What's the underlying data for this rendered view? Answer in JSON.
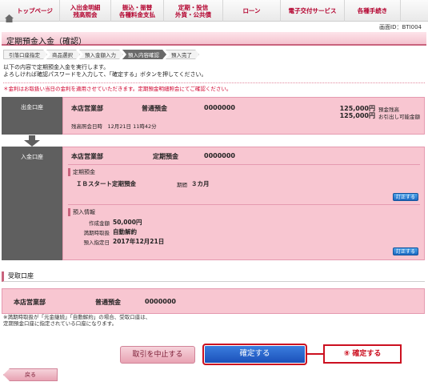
{
  "nav": {
    "items": [
      {
        "label": "トップページ"
      },
      {
        "label": "入出金明細\n残高照会"
      },
      {
        "label": "振込・振替\n各種料金支払"
      },
      {
        "label": "定期・投信\n外貨・公共債"
      },
      {
        "label": "ローン"
      },
      {
        "label": "電子交付サービス"
      },
      {
        "label": "各種手続き"
      }
    ]
  },
  "screen_id": "画面ID：BTI004",
  "page_title": "定期預金入金（確認）",
  "steps": [
    "引落口座指定",
    "商品選択",
    "預入金額入力",
    "預入内容確認",
    "預入完了"
  ],
  "instructions": {
    "line1": "以下の内容で定期預金入金を実行します。",
    "line2": "よろしければ確認パスワードを入力して、「確定する」ボタンを押してください。"
  },
  "notice": "＊金利はお取扱い当日の金利を適用させていただきます。定期預金明細照会にてご確認ください。",
  "withdrawal": {
    "label": "出金口座",
    "branch": "本店営業部",
    "type": "普通預金",
    "account": "0000000",
    "balance_amount": "125,000円",
    "balance_label": "預金残高",
    "available_amount": "125,000円",
    "available_label": "お引出し可能金額",
    "as_of": "残高照会日時　12月21日 11時42分"
  },
  "deposit": {
    "label": "入金口座",
    "branch": "本店営業部",
    "type": "定期預金",
    "account": "0000000",
    "product_section_title": "定期預金",
    "product_name": "ＩＢスタート定期預金",
    "term_label": "期間",
    "term_value": "３カ月",
    "edit_label": "訂正する",
    "info_section_title": "預入情報",
    "amount_label": "作成金額",
    "amount_value": "50,000円",
    "maturity_label": "満期時取扱",
    "maturity_value": "自動解約",
    "date_label": "預入指定日",
    "date_value": "2017年12月21日"
  },
  "receiving": {
    "title": "受取口座",
    "branch": "本店営業部",
    "type": "普通預金",
    "account": "0000000"
  },
  "note": {
    "line1": "※満期時取扱が「元金継続」「自動解約」の場合、受取口座は、",
    "line2": "定期預金口座に指定されている口座になります。"
  },
  "buttons": {
    "cancel": "取引を中止する",
    "confirm": "確定する",
    "back": "戻る"
  },
  "callout": "⑧ 確定する",
  "colors": {
    "accent": "#b3002d",
    "panel_pink": "#f8c6d1",
    "confirm_blue": "#1a4fb8",
    "callout_red": "#cc1020"
  }
}
